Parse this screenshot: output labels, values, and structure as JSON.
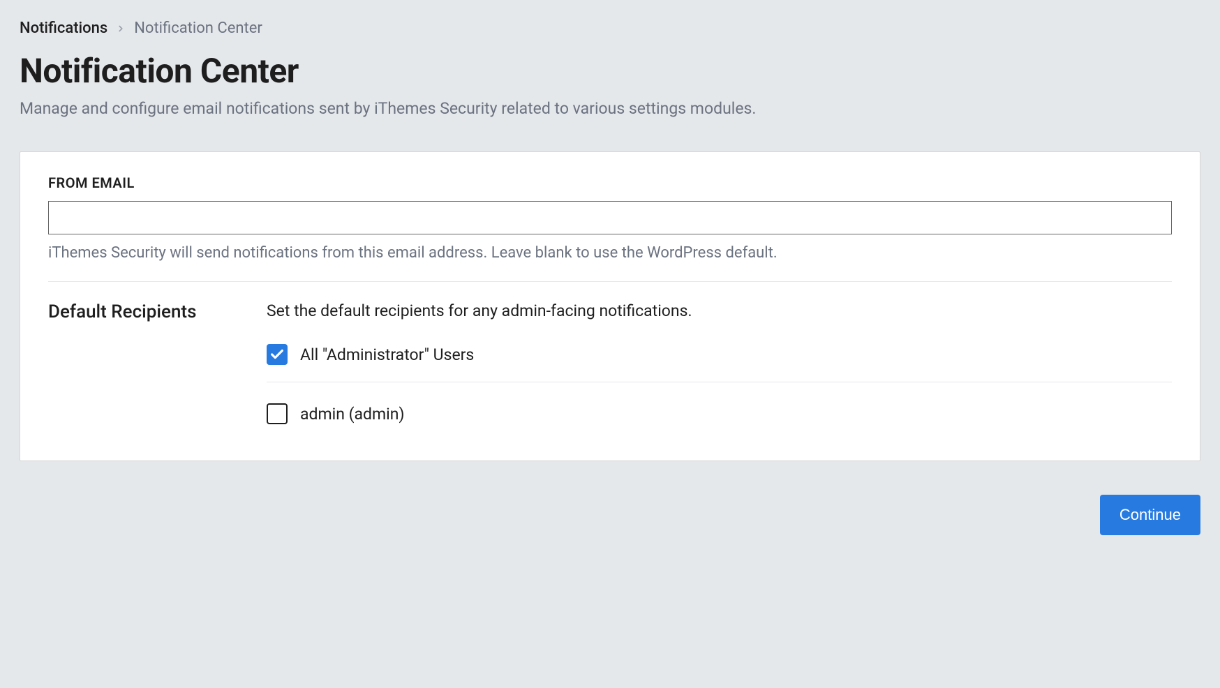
{
  "breadcrumb": {
    "parent": "Notifications",
    "current": "Notification Center"
  },
  "header": {
    "title": "Notification Center",
    "subtitle": "Manage and configure email notifications sent by iThemes Security related to various settings modules."
  },
  "from_email": {
    "label": "FROM EMAIL",
    "value": "",
    "help": "iThemes Security will send notifications from this email address. Leave blank to use the WordPress default."
  },
  "default_recipients": {
    "heading": "Default Recipients",
    "description": "Set the default recipients for any admin-facing notifications.",
    "options": [
      {
        "label": "All \"Administrator\" Users",
        "checked": true
      },
      {
        "label": "admin (admin)",
        "checked": false
      }
    ]
  },
  "actions": {
    "continue": "Continue"
  },
  "colors": {
    "primary": "#277BE0"
  }
}
